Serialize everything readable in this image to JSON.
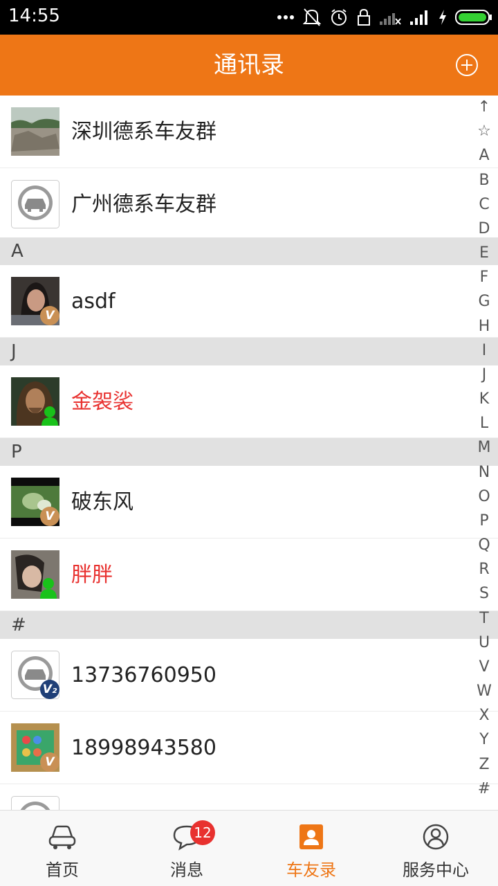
{
  "status_bar": {
    "time": "14:55"
  },
  "header": {
    "title": "通讯录"
  },
  "groups": [
    {
      "name": "深圳德系车友群"
    },
    {
      "name": "广州德系车友群"
    }
  ],
  "sections": [
    {
      "letter": "A",
      "contacts": [
        {
          "name": "asdf",
          "badge": "V"
        }
      ]
    },
    {
      "letter": "J",
      "contacts": [
        {
          "name": "金袈裟",
          "highlight": true
        }
      ]
    },
    {
      "letter": "P",
      "contacts": [
        {
          "name": "破东风",
          "badge": "V"
        },
        {
          "name": "胖胖",
          "highlight": true
        }
      ]
    },
    {
      "letter": "#",
      "contacts": [
        {
          "name": "13736760950",
          "badge": "V2"
        },
        {
          "name": "18998943580",
          "badge": "V"
        }
      ]
    }
  ],
  "index_bar": [
    "↑",
    "☆",
    "A",
    "B",
    "C",
    "D",
    "E",
    "F",
    "G",
    "H",
    "I",
    "J",
    "K",
    "L",
    "M",
    "N",
    "O",
    "P",
    "Q",
    "R",
    "S",
    "T",
    "U",
    "V",
    "W",
    "X",
    "Y",
    "Z",
    "#"
  ],
  "tabs": [
    {
      "label": "首页",
      "icon": "car-icon"
    },
    {
      "label": "消息",
      "icon": "chat-bubble-icon",
      "badge": "12"
    },
    {
      "label": "车友录",
      "icon": "contacts-icon",
      "active": true
    },
    {
      "label": "服务中心",
      "icon": "user-circle-icon"
    }
  ],
  "colors": {
    "accent": "#ee7616",
    "highlight_name": "#e8312f",
    "section_bg": "#e1e1e1"
  }
}
